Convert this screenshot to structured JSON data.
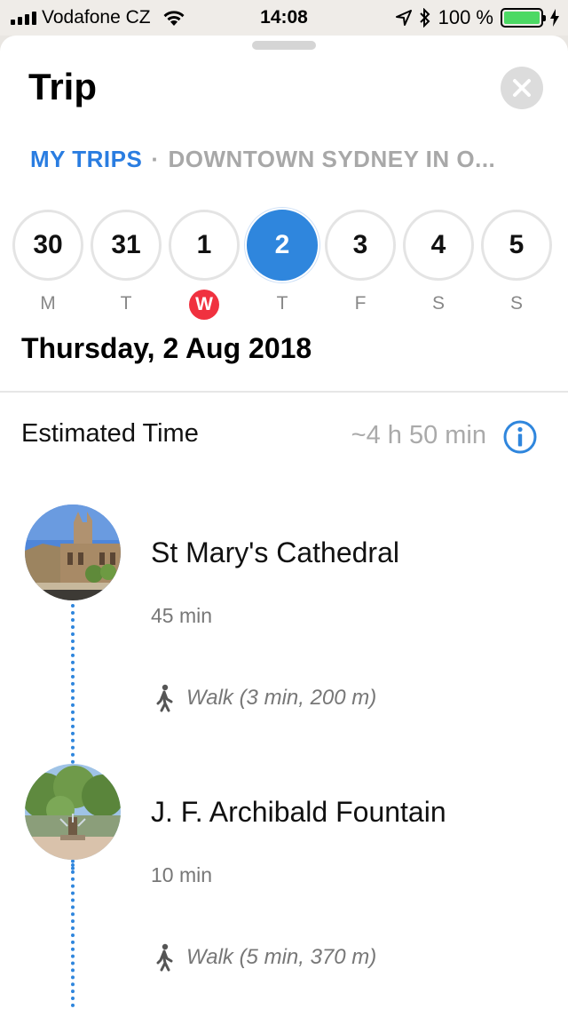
{
  "status_bar": {
    "carrier": "Vodafone CZ",
    "time": "14:08",
    "battery": "100 %"
  },
  "sheet": {
    "title": "Trip"
  },
  "breadcrumb": {
    "link": "MY TRIPS",
    "separator": "·",
    "current": "DOWNTOWN SYDNEY IN O..."
  },
  "days": [
    {
      "number": "30",
      "letter": "M"
    },
    {
      "number": "31",
      "letter": "T"
    },
    {
      "number": "1",
      "letter": "W"
    },
    {
      "number": "2",
      "letter": "T"
    },
    {
      "number": "3",
      "letter": "F"
    },
    {
      "number": "4",
      "letter": "S"
    },
    {
      "number": "5",
      "letter": "S"
    }
  ],
  "selected_day_index": 3,
  "today_day_index": 2,
  "date_heading": "Thursday, 2 Aug 2018",
  "estimate": {
    "label": "Estimated Time",
    "value": "~4 h 50 min"
  },
  "places": [
    {
      "name": "St Mary's Cathedral",
      "duration": "45 min",
      "walk": "Walk (3 min, 200 m)"
    },
    {
      "name": "J. F. Archibald Fountain",
      "duration": "10 min",
      "walk": "Walk (5 min, 370 m)"
    }
  ],
  "colors": {
    "accent": "#2f86dd",
    "today": "#f0313f",
    "muted": "#a8a8a8"
  },
  "icons": [
    "signal-bars-icon",
    "wifi-icon",
    "location-arrow-icon",
    "bluetooth-icon",
    "battery-icon",
    "charging-bolt-icon",
    "close-icon",
    "info-icon",
    "walk-icon"
  ]
}
